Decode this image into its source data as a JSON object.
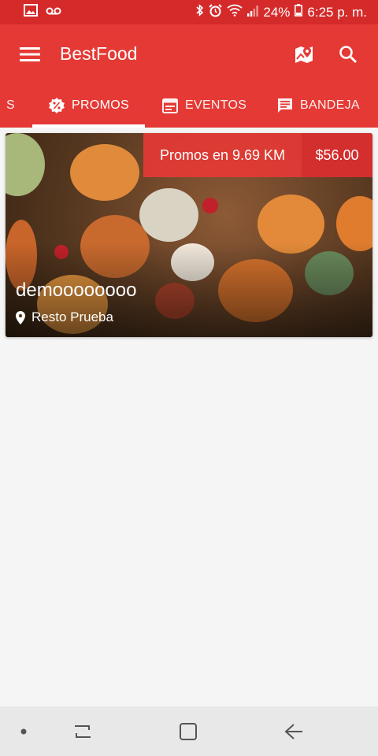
{
  "status_bar": {
    "battery": "24%",
    "time": "6:25 p. m.",
    "icons": [
      "image-icon",
      "voicemail-icon",
      "bluetooth-icon",
      "alarm-icon",
      "wifi-icon",
      "signal-icon",
      "battery-icon"
    ]
  },
  "app_bar": {
    "title": "BestFood",
    "actions": [
      "map-marker-icon",
      "search-icon"
    ]
  },
  "tabs": [
    {
      "label": "S",
      "icon": "truncated"
    },
    {
      "label": "PROMOS",
      "icon": "discount-icon",
      "selected": true
    },
    {
      "label": "EVENTOS",
      "icon": "calendar-icon"
    },
    {
      "label": "BANDEJA",
      "icon": "message-icon"
    }
  ],
  "card": {
    "promo_text": "Promos en 9.69 KM",
    "price": "$56.00",
    "title": "demoooooooo",
    "location": "Resto Prueba"
  },
  "nav_bar": {
    "items": [
      "dot-indicator",
      "recents-icon",
      "home-icon",
      "back-icon"
    ]
  },
  "colors": {
    "primary": "#e53935",
    "status_bar": "#d52a2a",
    "price_badge": "#d32f2f",
    "background": "#f5f5f5"
  }
}
